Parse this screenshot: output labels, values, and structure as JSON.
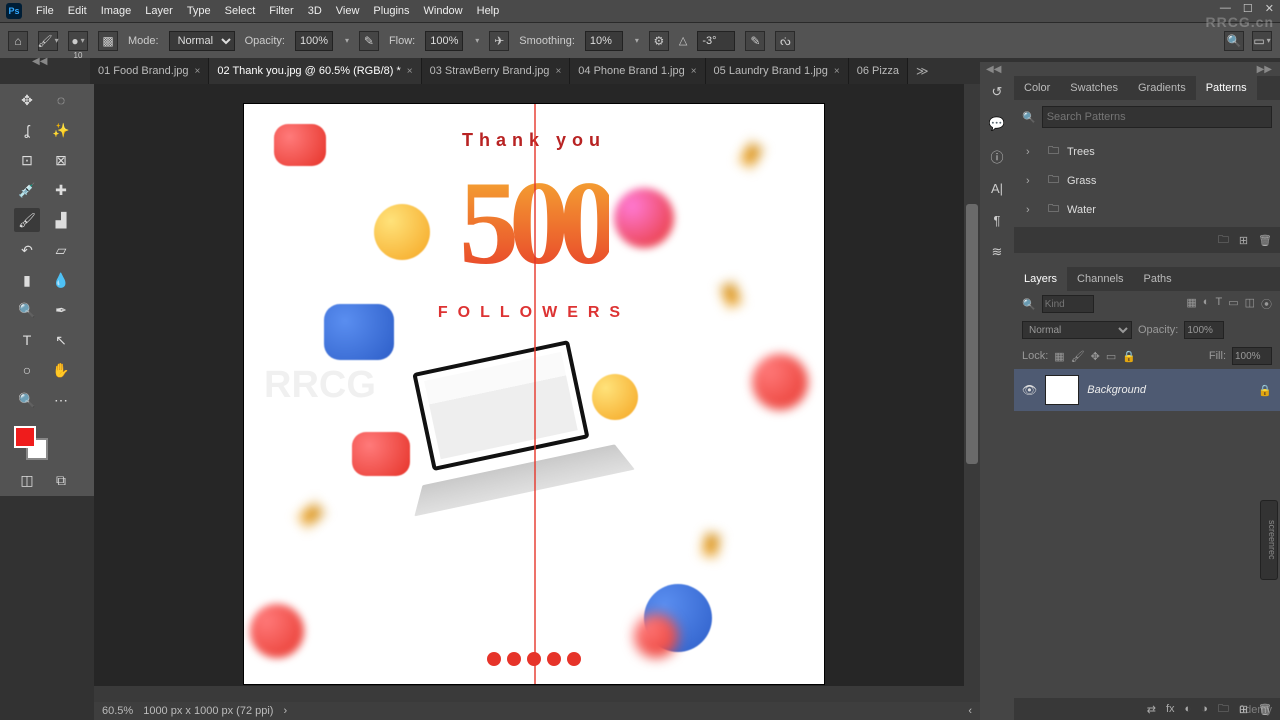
{
  "app_logo": "Ps",
  "menu": [
    "File",
    "Edit",
    "Image",
    "Layer",
    "Type",
    "Select",
    "Filter",
    "3D",
    "View",
    "Plugins",
    "Window",
    "Help"
  ],
  "options": {
    "brush_size": "10",
    "mode_label": "Mode:",
    "mode_value": "Normal",
    "opacity_label": "Opacity:",
    "opacity_value": "100%",
    "flow_label": "Flow:",
    "flow_value": "100%",
    "smoothing_label": "Smoothing:",
    "smoothing_value": "10%",
    "angle_icon_label": "△",
    "angle_value": "-3°"
  },
  "doc_tabs": [
    {
      "label": "01 Food Brand.jpg",
      "active": false
    },
    {
      "label": "02 Thank you.jpg @ 60.5% (RGB/8) *",
      "active": true
    },
    {
      "label": "03 StrawBerry Brand.jpg",
      "active": false
    },
    {
      "label": "04 Phone Brand 1.jpg",
      "active": false
    },
    {
      "label": "05 Laundry Brand 1.jpg",
      "active": false
    },
    {
      "label": "06 Pizza",
      "active": false
    }
  ],
  "status": {
    "zoom": "60.5%",
    "doc_info": "1000 px x 1000 px (72 ppi)"
  },
  "colors": {
    "foreground": "#ef1c1c",
    "background": "#ffffff"
  },
  "canvas_text": {
    "thankyou": "Thank you",
    "big": "500",
    "followers": "FOLLOWERS"
  },
  "patterns_panel": {
    "tabs": [
      "Color",
      "Swatches",
      "Gradients",
      "Patterns"
    ],
    "active_tab": 3,
    "search_placeholder": "Search Patterns",
    "folders": [
      "Trees",
      "Grass",
      "Water"
    ]
  },
  "layers_panel": {
    "tabs": [
      "Layers",
      "Channels",
      "Paths"
    ],
    "active_tab": 0,
    "filter_placeholder": "Kind",
    "blend_mode": "Normal",
    "opacity_label": "Opacity:",
    "opacity_value": "100%",
    "lock_label": "Lock:",
    "fill_label": "Fill:",
    "fill_value": "100%",
    "layer_name": "Background"
  },
  "watermarks": {
    "tr": "RRCG.cn",
    "udemy": "ûdemy",
    "screenrec": "screenrec",
    "canvas": "RRCG"
  }
}
